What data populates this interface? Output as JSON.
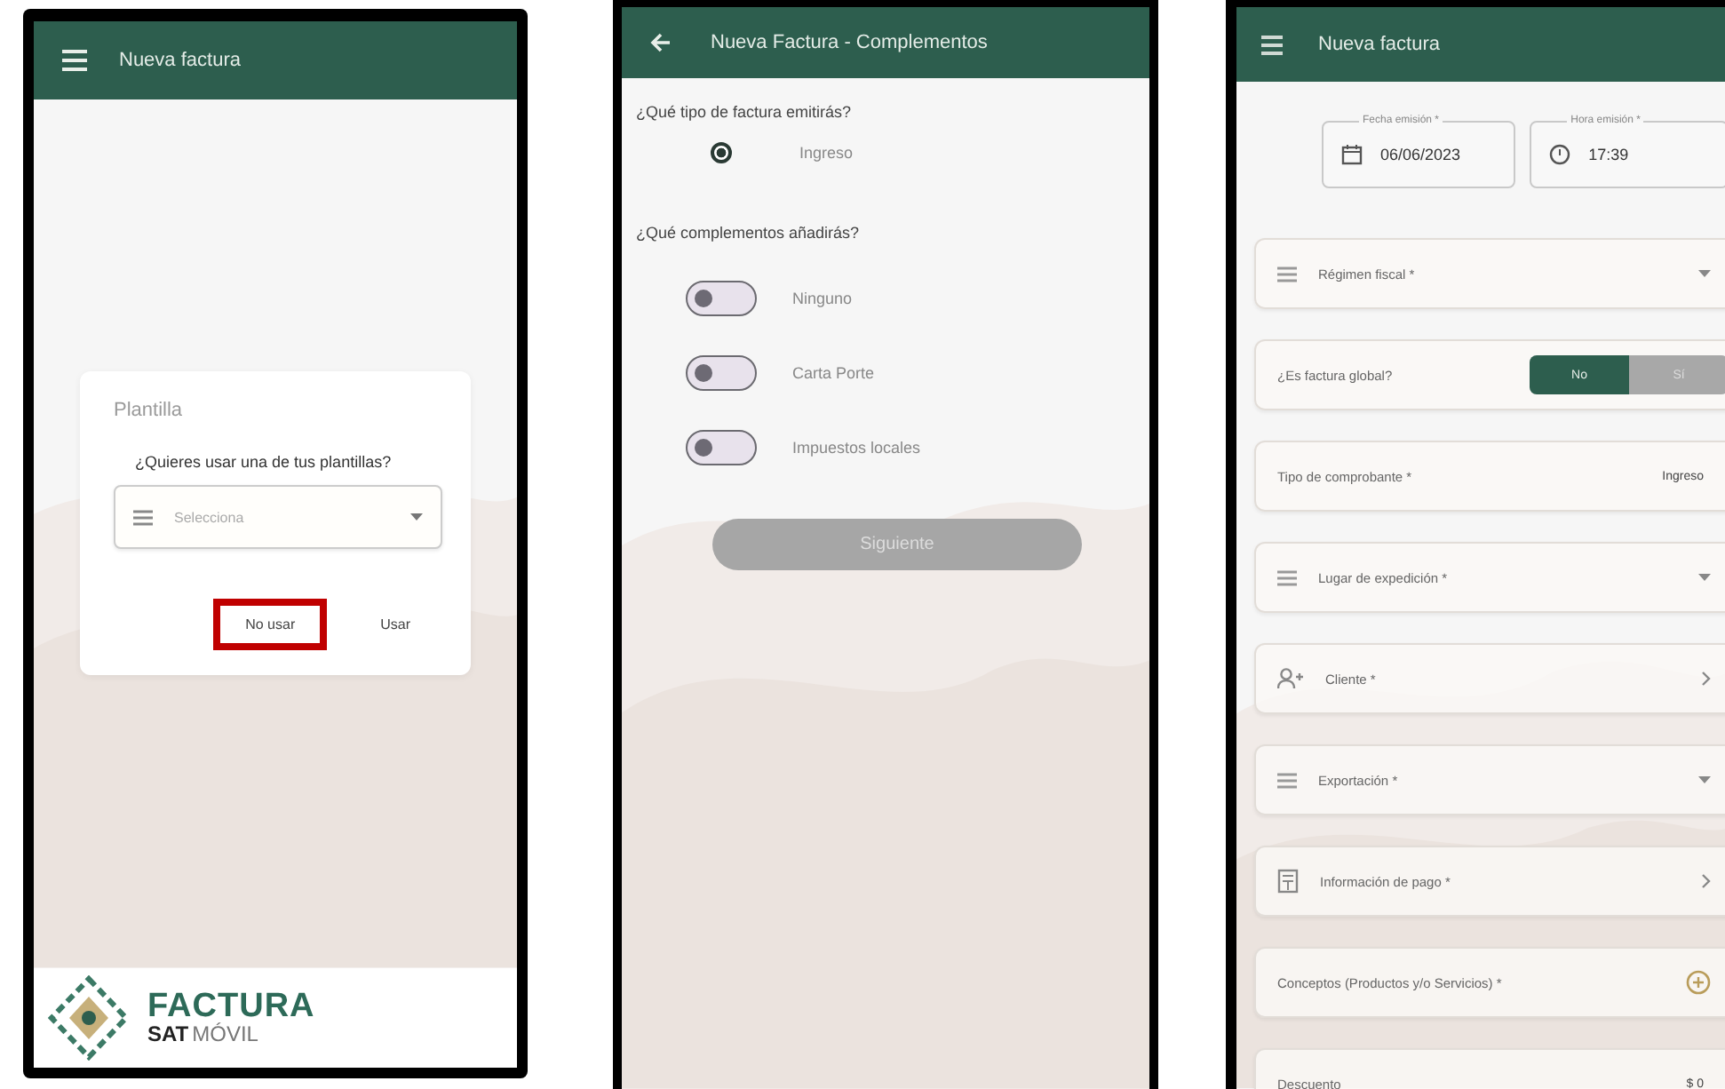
{
  "template_screen": {
    "title": "Nueva factura",
    "dialog_title": "Plantilla",
    "question": "¿Quieres usar una de tus plantillas?",
    "select_placeholder": "Selecciona",
    "buttons": [
      {
        "label": "No usar",
        "highlighted": true
      },
      {
        "label": "Usar",
        "highlighted": false
      }
    ],
    "logo": {
      "word": "FACTURA",
      "brand": "SAT",
      "suffix": "MÓVIL"
    }
  },
  "complements_screen": {
    "title": "Nueva Factura - Complementos",
    "type_question": "¿Qué tipo de factura emitirás?",
    "types": [
      {
        "label": "Ingreso",
        "selected": true
      }
    ],
    "complements_question": "¿Qué complementos añadirás?",
    "complements": [
      {
        "label": "Ninguno",
        "on": false
      },
      {
        "label": "Carta Porte",
        "on": false
      },
      {
        "label": "Impuestos locales",
        "on": false
      }
    ],
    "next_button": {
      "label": "Siguiente",
      "disabled": true
    }
  },
  "invoice_form_screen": {
    "title": "Nueva factura",
    "date": {
      "label": "Fecha emisión *",
      "value": "06/06/2023"
    },
    "time": {
      "label": "Hora emisión *",
      "value": "17:39"
    },
    "fields": [
      {
        "kind": "select",
        "label": "Régimen fiscal *"
      },
      {
        "kind": "segmented",
        "label": "¿Es factura global?",
        "options": [
          {
            "label": "No",
            "selected": true
          },
          {
            "label": "Sí",
            "selected": false
          }
        ]
      },
      {
        "kind": "value",
        "label": "Tipo de comprobante *",
        "value": "Ingreso"
      },
      {
        "kind": "select",
        "label": "Lugar de expedición *"
      },
      {
        "kind": "client",
        "label": "Cliente *"
      },
      {
        "kind": "select",
        "label": "Exportación *"
      },
      {
        "kind": "payment",
        "label": "Información de pago *"
      },
      {
        "kind": "add",
        "label": "Conceptos (Productos y/o Servicios) *"
      },
      {
        "kind": "value",
        "label": "Descuento",
        "value": "$ 0"
      }
    ]
  }
}
